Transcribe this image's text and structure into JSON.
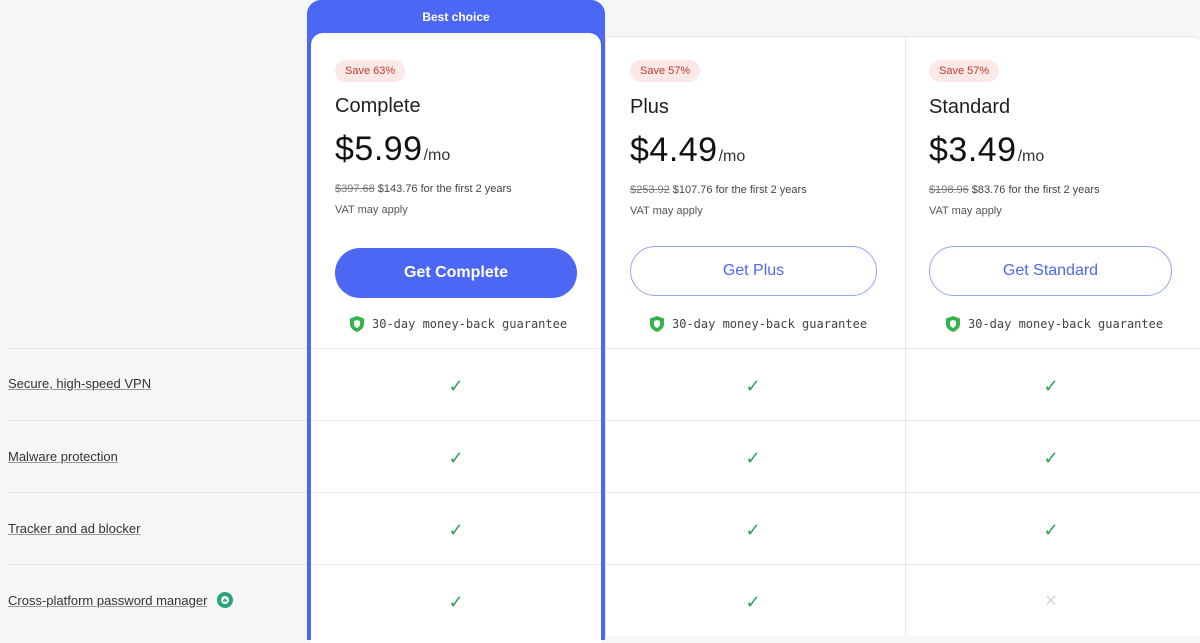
{
  "featured_badge": "Best choice",
  "plans": [
    {
      "id": "complete",
      "save": "Save 63%",
      "name": "Complete",
      "price": "$5.99",
      "period": "/mo",
      "old_price": "$397.68",
      "new_price": "$143.76",
      "term": "for the first 2 years",
      "vat": "VAT may apply",
      "cta": "Get Complete",
      "guarantee": "30-day money-back guarantee"
    },
    {
      "id": "plus",
      "save": "Save 57%",
      "name": "Plus",
      "price": "$4.49",
      "period": "/mo",
      "old_price": "$253.92",
      "new_price": "$107.76",
      "term": "for the first 2 years",
      "vat": "VAT may apply",
      "cta": "Get Plus",
      "guarantee": "30-day money-back guarantee"
    },
    {
      "id": "standard",
      "save": "Save 57%",
      "name": "Standard",
      "price": "$3.49",
      "period": "/mo",
      "old_price": "$198.96",
      "new_price": "$83.76",
      "term": "for the first 2 years",
      "vat": "VAT may apply",
      "cta": "Get Standard",
      "guarantee": "30-day money-back guarantee"
    }
  ],
  "features": [
    {
      "label": "Secure, high-speed VPN",
      "included": [
        true,
        true,
        true
      ]
    },
    {
      "label": "Malware protection",
      "included": [
        true,
        true,
        true
      ]
    },
    {
      "label": "Tracker and ad blocker",
      "included": [
        true,
        true,
        true
      ]
    },
    {
      "label": "Cross-platform password manager",
      "included": [
        true,
        true,
        false
      ],
      "icon": "password-manager-icon"
    }
  ],
  "symbols": {
    "check": "✓",
    "cross": "✕"
  },
  "colors": {
    "accent": "#4c67f4",
    "check": "#2e9e55",
    "save_badge_bg": "#fde8e8",
    "save_badge_text": "#c0392b",
    "shield": "#35b34a"
  }
}
